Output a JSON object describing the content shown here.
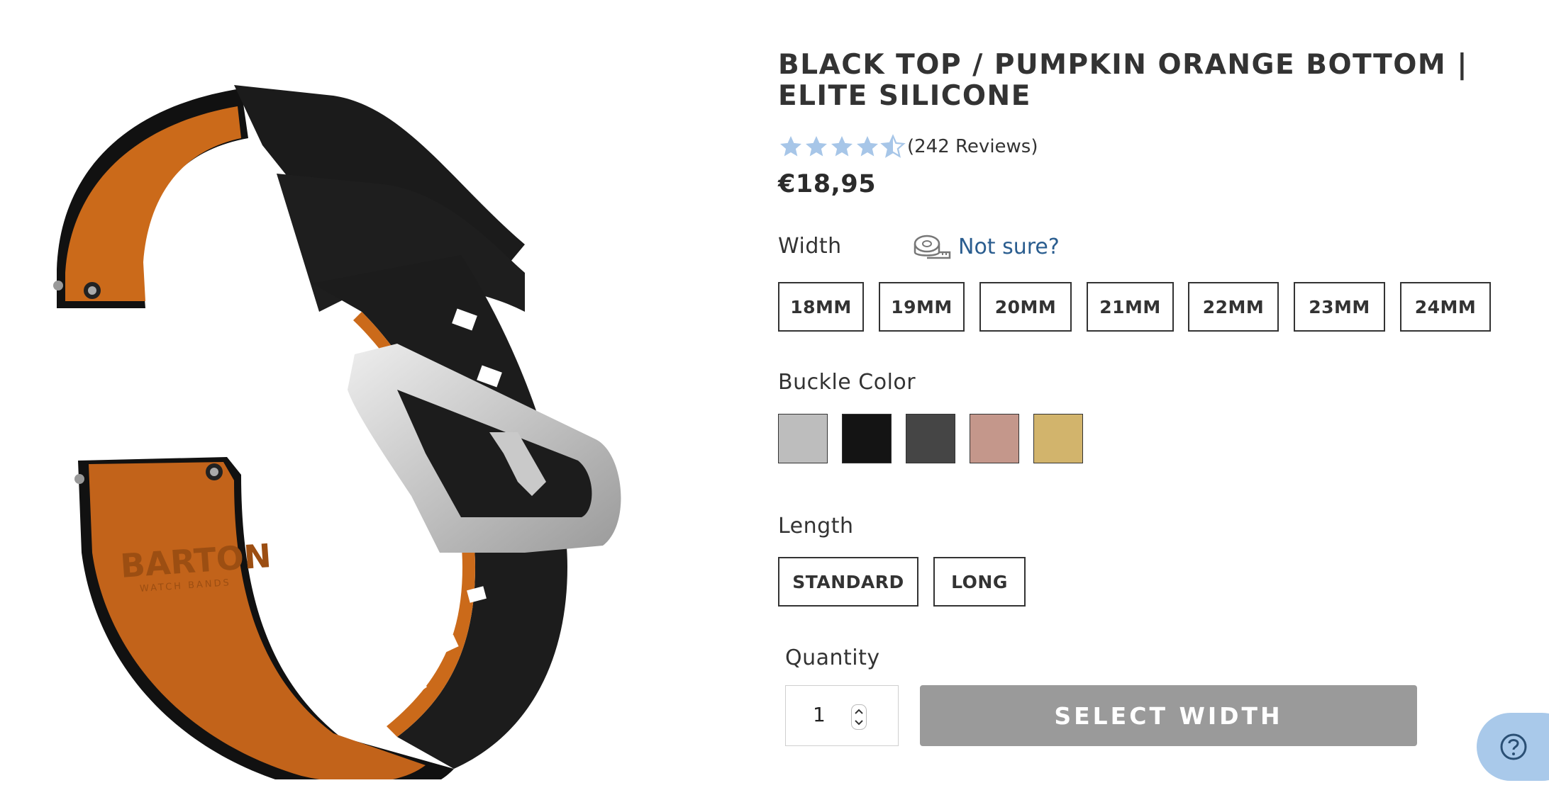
{
  "product": {
    "title": "BLACK TOP / PUMPKIN ORANGE BOTTOM | ELITE SILICONE",
    "rating": 4.5,
    "reviews_label": "(242 Reviews)",
    "price": "€18,95",
    "image_alt": "Black top / pumpkin orange bottom silicone watch band with brushed silver buckle",
    "image_logo": "BARTON",
    "image_logo_sub": "WATCH BANDS"
  },
  "width": {
    "label": "Width",
    "help_label": "Not sure?",
    "help_icon": "measuring-tape-icon",
    "options": [
      "18MM",
      "19MM",
      "20MM",
      "21MM",
      "22MM",
      "23MM",
      "24MM"
    ]
  },
  "buckle": {
    "label": "Buckle Color",
    "swatches": [
      {
        "color": "#bdbdbd"
      },
      {
        "color": "#141414"
      },
      {
        "color": "#454545"
      },
      {
        "color": "#c4978b"
      },
      {
        "color": "#d2b46c"
      }
    ]
  },
  "length": {
    "label": "Length",
    "options": [
      "STANDARD",
      "LONG"
    ]
  },
  "quantity": {
    "label": "Quantity",
    "value": "1"
  },
  "cta": {
    "label": "SELECT WIDTH",
    "color": "#9a9a9a"
  },
  "help_widget": {
    "icon": "question-icon"
  },
  "colors": {
    "star": "#a7c6e8",
    "link": "#2a5d8f",
    "text": "#333333"
  }
}
